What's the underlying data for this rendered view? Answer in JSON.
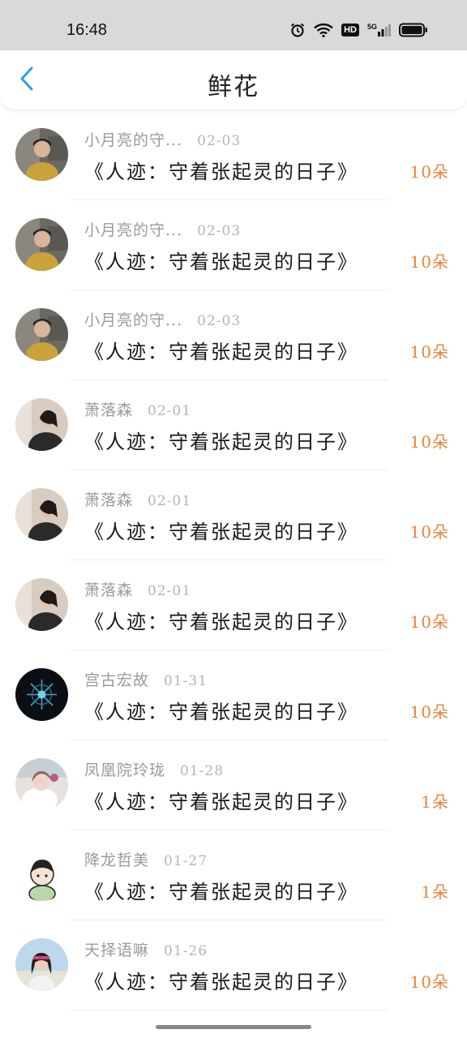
{
  "status_bar": {
    "time": "16:48",
    "hd_label": "HD",
    "network_label": "5G",
    "icons": [
      "alarm-icon",
      "wifi-icon",
      "hd-icon",
      "signal-5g-icon",
      "battery-icon"
    ]
  },
  "header": {
    "title": "鲜花",
    "back_icon": "chevron-left-icon",
    "accent_color": "#2a9df4"
  },
  "colors": {
    "amount": "#e8833a",
    "name": "#9a9a9a",
    "date": "#b5b5b5"
  },
  "items": [
    {
      "name": "小月亮的守...",
      "date": "02-03",
      "title": "《人迹：守着张起灵的日子》",
      "amount": "10朵",
      "avatar": "man-yellow-shirt"
    },
    {
      "name": "小月亮的守...",
      "date": "02-03",
      "title": "《人迹：守着张起灵的日子》",
      "amount": "10朵",
      "avatar": "man-yellow-shirt"
    },
    {
      "name": "小月亮的守...",
      "date": "02-03",
      "title": "《人迹：守着张起灵的日子》",
      "amount": "10朵",
      "avatar": "man-yellow-shirt"
    },
    {
      "name": "萧落森",
      "date": "02-01",
      "title": "《人迹：守着张起灵的日子》",
      "amount": "10朵",
      "avatar": "woman-dark-hair"
    },
    {
      "name": "萧落森",
      "date": "02-01",
      "title": "《人迹：守着张起灵的日子》",
      "amount": "10朵",
      "avatar": "woman-dark-hair"
    },
    {
      "name": "萧落森",
      "date": "02-01",
      "title": "《人迹：守着张起灵的日子》",
      "amount": "10朵",
      "avatar": "woman-dark-hair"
    },
    {
      "name": "宫古宏故",
      "date": "01-31",
      "title": "《人迹：守着张起灵的日子》",
      "amount": "10朵",
      "avatar": "dark-snowflake"
    },
    {
      "name": "凤凰院玲珑",
      "date": "01-28",
      "title": "《人迹：守着张起灵的日子》",
      "amount": "1朵",
      "avatar": "anime-pastel"
    },
    {
      "name": "降龙哲美",
      "date": "01-27",
      "title": "《人迹：守着张起灵的日子》",
      "amount": "1朵",
      "avatar": "cartoon-boy"
    },
    {
      "name": "天择语嘛",
      "date": "01-26",
      "title": "《人迹：守着张起灵的日子》",
      "amount": "10朵",
      "avatar": "girl-blue-sky"
    }
  ]
}
